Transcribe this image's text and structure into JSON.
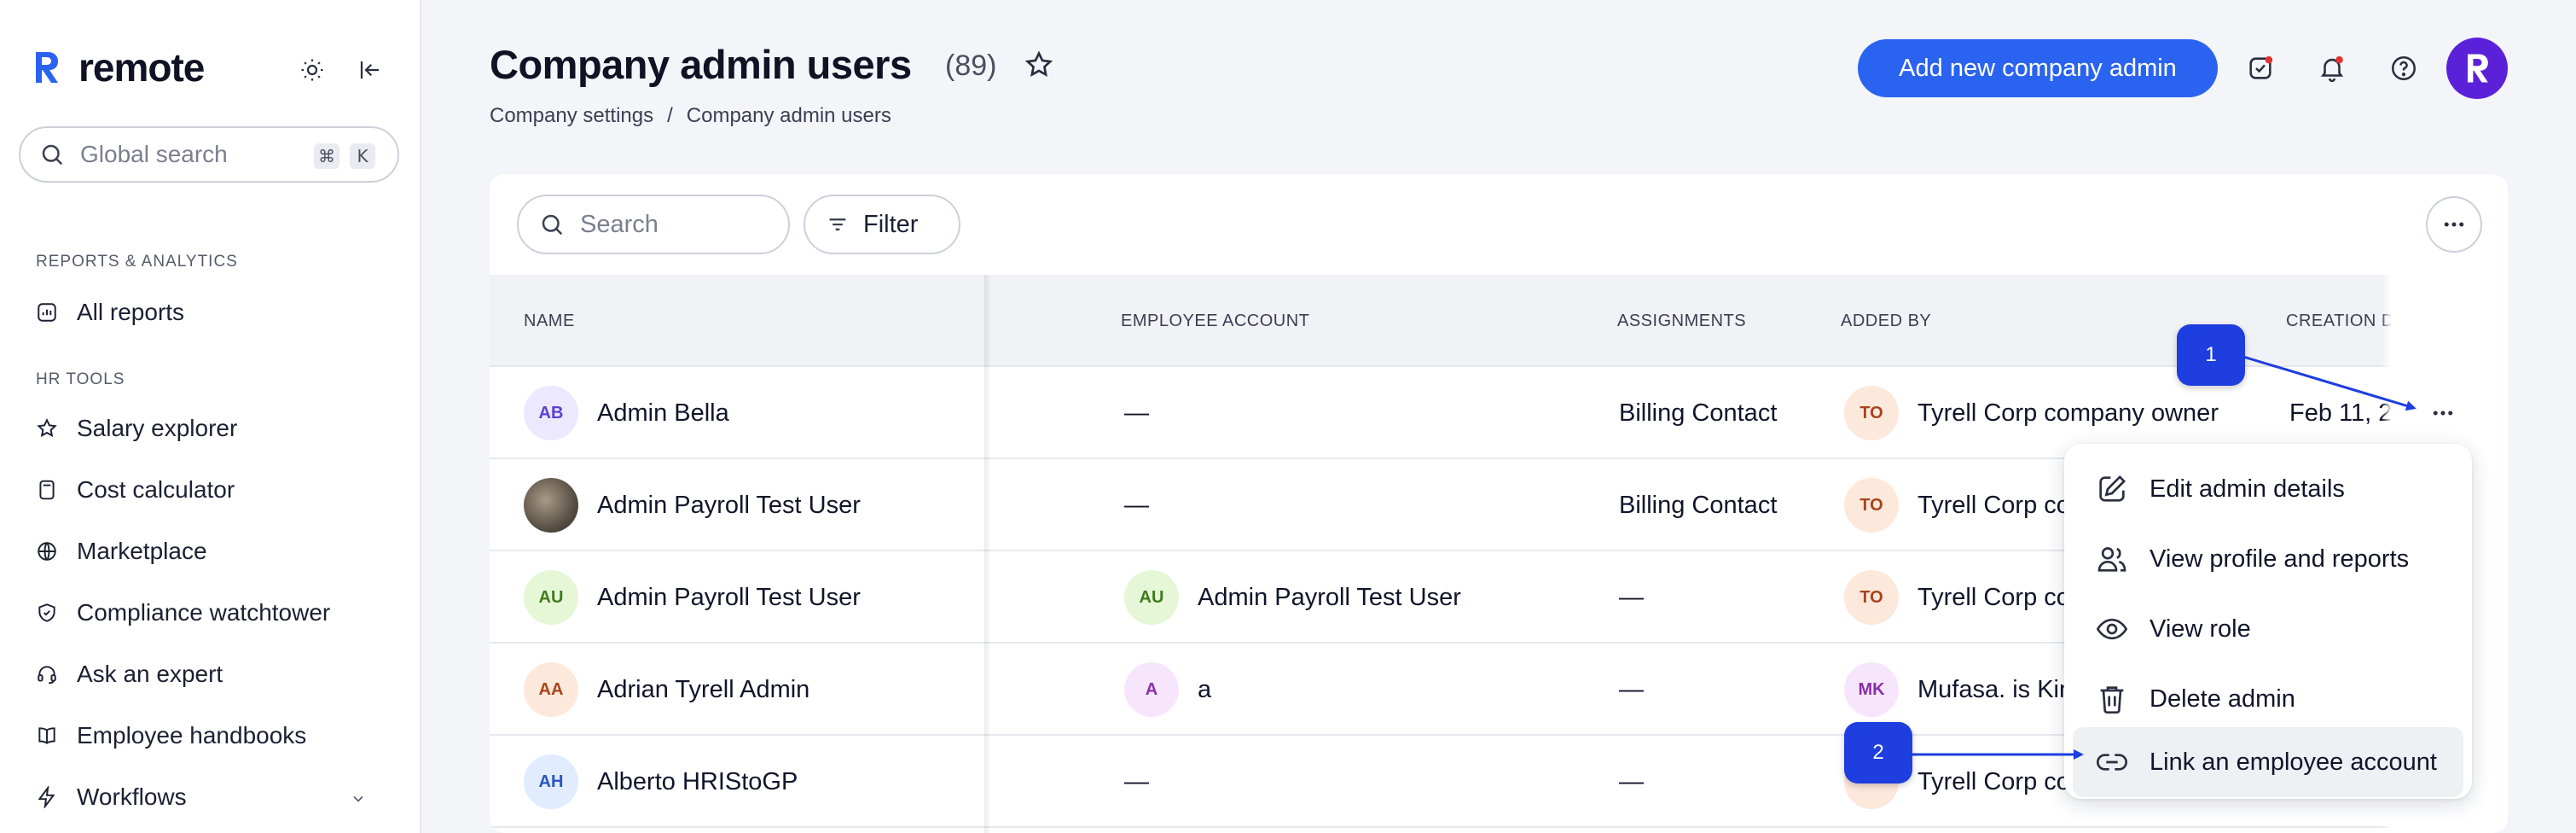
{
  "sidebar": {
    "logo_text": "remote",
    "search_placeholder": "Global search",
    "search_kbd": [
      "⌘",
      "K"
    ],
    "sections": [
      {
        "label": "REPORTS & ANALYTICS",
        "items": [
          {
            "label": "All reports",
            "icon": "reports-icon"
          }
        ]
      },
      {
        "label": "HR TOOLS",
        "items": [
          {
            "label": "Salary explorer",
            "icon": "star-icon"
          },
          {
            "label": "Cost calculator",
            "icon": "calculator-icon"
          },
          {
            "label": "Marketplace",
            "icon": "globe-icon"
          },
          {
            "label": "Compliance watchtower",
            "icon": "shield-icon"
          },
          {
            "label": "Ask an expert",
            "icon": "headset-icon"
          },
          {
            "label": "Employee handbooks",
            "icon": "book-icon"
          },
          {
            "label": "Workflows",
            "icon": "lightning-icon"
          }
        ]
      }
    ]
  },
  "header": {
    "title": "Company admin users",
    "count": "(89)",
    "breadcrumb": [
      "Company settings",
      "/",
      "Company admin users"
    ],
    "primary_button": "Add new company admin"
  },
  "toolbar": {
    "search_placeholder": "Search",
    "filter_label": "Filter"
  },
  "table": {
    "columns": [
      "NAME",
      "EMPLOYEE ACCOUNT",
      "ASSIGNMENTS",
      "ADDED BY",
      "CREATION D"
    ],
    "rows": [
      {
        "initials": "AB",
        "name": "Admin Bella",
        "emp_initials": "",
        "employee": "—",
        "assignments": "Billing Contact",
        "added_initials": "TO",
        "added_by": "Tyrell Corp company owner",
        "created": "Feb 11, 2"
      },
      {
        "initials": "",
        "name": "Admin Payroll Test User",
        "emp_initials": "",
        "employee": "—",
        "assignments": "Billing Contact",
        "added_initials": "TO",
        "added_by": "Tyrell Corp co",
        "created": ""
      },
      {
        "initials": "AU",
        "name": "Admin Payroll Test User",
        "emp_initials": "AU",
        "employee": "Admin Payroll Test User",
        "assignments": "—",
        "added_initials": "TO",
        "added_by": "Tyrell Corp co",
        "created": ""
      },
      {
        "initials": "AA",
        "name": "Adrian Tyrell Admin",
        "emp_initials": "A",
        "employee": "a",
        "assignments": "—",
        "added_initials": "MK",
        "added_by": "Mufasa. is Kin",
        "created": ""
      },
      {
        "initials": "AH",
        "name": "Alberto HRIStoGP",
        "emp_initials": "",
        "employee": "—",
        "assignments": "—",
        "added_initials": "",
        "added_by": "Tyrell Corp co",
        "created": ""
      }
    ]
  },
  "context_menu": {
    "items": [
      {
        "label": "Edit admin details",
        "icon": "edit-icon"
      },
      {
        "label": "View profile and reports",
        "icon": "users-icon"
      },
      {
        "label": "View role",
        "icon": "eye-icon"
      },
      {
        "label": "Delete admin",
        "icon": "trash-icon"
      },
      {
        "label": "Link an employee account",
        "icon": "link-icon"
      }
    ]
  },
  "callouts": [
    "1",
    "2"
  ],
  "colors": {
    "primary": "#2a63f0",
    "callout": "#1f3ee0",
    "avatar": "#5b21d9"
  }
}
